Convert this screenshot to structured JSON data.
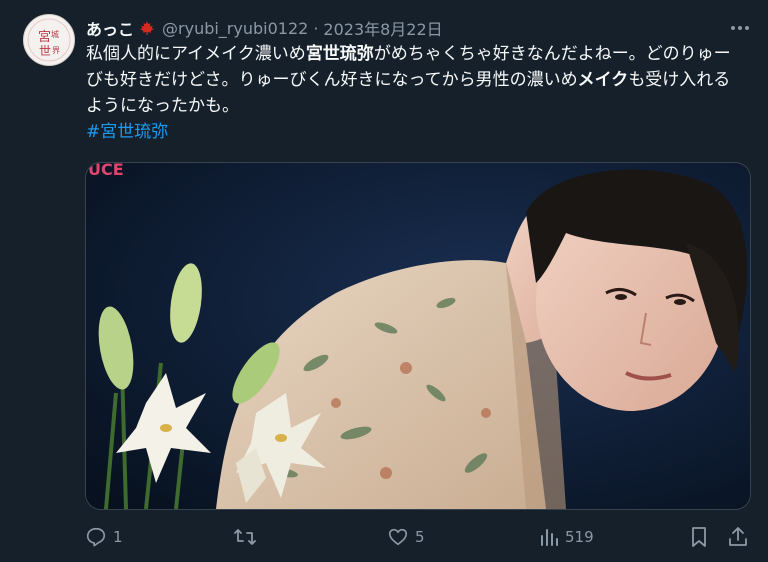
{
  "tweet": {
    "display_name": "あっこ",
    "flag": "maple-leaf-icon",
    "handle": "@ryubi_ryubi0122",
    "separator": "·",
    "date": "2023年8月22日",
    "text": {
      "part1": "私個人的にアイメイク濃いめ",
      "bold1": "宮世琉弥",
      "part2": "がめちゃくちゃ好きなんだよねー。どのりゅーびも好きだけどさ。りゅーびくん好きになってから男性の濃いめ",
      "bold2": "メイク",
      "part3": "も受け入れるようになったかも。"
    },
    "hashtag": "#宮世琉弥"
  },
  "avatar": {
    "text": "宮城世界"
  },
  "media": {
    "description": "photo",
    "fragment": "UCE"
  },
  "actions": {
    "reply": {
      "icon": "reply-icon",
      "count": "1"
    },
    "retweet": {
      "icon": "retweet-icon",
      "count": ""
    },
    "like": {
      "icon": "heart-icon",
      "count": "5"
    },
    "views": {
      "icon": "analytics-icon",
      "count": "519"
    },
    "bookmark": {
      "icon": "bookmark-icon"
    },
    "share": {
      "icon": "share-icon"
    }
  },
  "colors": {
    "background": "#15202b",
    "text": "#f7f9f9",
    "secondary": "#8b98a5",
    "link": "#1d9bf0",
    "flag": "#d52b1e"
  }
}
